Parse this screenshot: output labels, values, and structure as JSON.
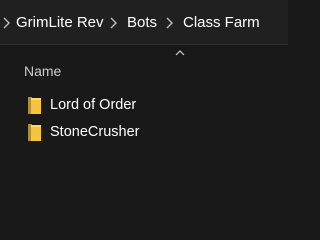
{
  "breadcrumb": {
    "items": [
      {
        "label": "GrimLite Rev"
      },
      {
        "label": "Bots"
      },
      {
        "label": "Class Farm"
      }
    ]
  },
  "list": {
    "columns": [
      {
        "label": "Name"
      }
    ],
    "items": [
      {
        "name": "Lord of Order",
        "icon": "folder-icon"
      },
      {
        "name": "StoneCrusher",
        "icon": "folder-icon"
      }
    ]
  },
  "colors": {
    "background": "#191919",
    "breadcrumb_bar": "#202020",
    "folder": "#f4c542",
    "text": "#ffffff",
    "muted_text": "#cccccc"
  }
}
